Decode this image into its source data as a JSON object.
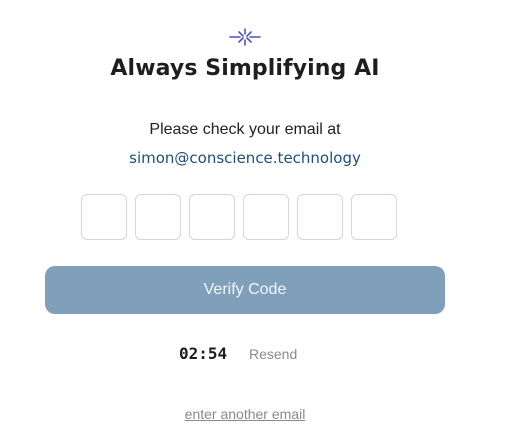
{
  "brand": {
    "logo_icon": "sparkle-cross-icon",
    "logo_color": "#4a52c9",
    "title": "Always Simplifying AI"
  },
  "verification": {
    "prompt": "Please check your email at",
    "email": "simon@conscience.technology",
    "code_length": 6,
    "code_values": [
      "",
      "",
      "",
      "",
      "",
      ""
    ]
  },
  "actions": {
    "verify_label": "Verify Code",
    "verify_color": "#7f9fba",
    "timer": "02:54",
    "resend_label": "Resend",
    "another_email_label": "enter another email"
  }
}
